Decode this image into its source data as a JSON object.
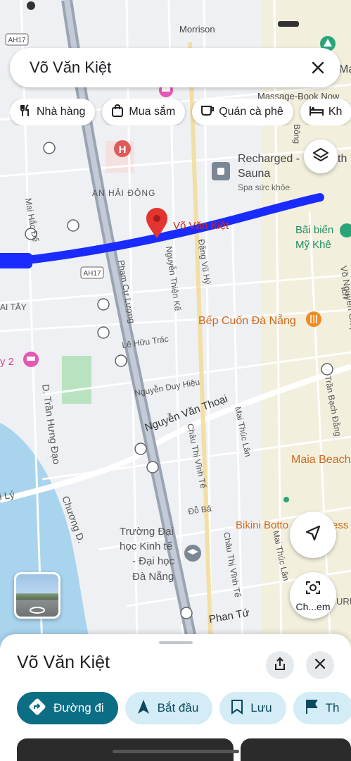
{
  "map": {
    "route_color": "#1a2bff",
    "pin_label": "Võ Văn Kiệt",
    "highway_labels": [
      "AH17",
      "AH17"
    ],
    "places": {
      "morrison": "Morrison",
      "massage": "Massage-Book Now",
      "recharged": "Recharged - ",
      "recharged_suffix": "th",
      "sauna": "Sauna",
      "spa": "Spa sức khỏe",
      "an_hai_dong": "AN HẢI ĐÔNG",
      "bai_bien": "Bãi biển",
      "my_khe": "Mỹ Khê",
      "bep_cuon": "Bếp Cuốn Đà Nẵng",
      "maia_beach": "Maia Beach",
      "bikini": "Bikini Botto",
      "bikini_suffix": "ess",
      "truong_dh1": "Trường Đại",
      "truong_dh2": "học Kinh tế",
      "truong_dh3": "- Đại học",
      "truong_dh4": "Đà Nẵng",
      "hotel_2": "y 2",
      "ai_tay": "AI TÂY",
      "ma_edge": "Ma",
      "uru": "URU",
      "bong": "Bông"
    },
    "streets": {
      "mai_hac_de": "Mai Hắc Đế",
      "pham_cu_luong": "Phạm Cự Lượng",
      "nguyen_thien_ke": "Nguyễn Thiện Kế",
      "dang_vu_hy": "Đặng Vũ Hỷ",
      "vo_nguyen_giap": "Võ Nguyên Giáp",
      "le_huu_trac": "Lê Hữu Trác",
      "nguyen_duy_hieu": "Nguyễn Duy Hiệu",
      "nguyen_van_thoai": "Nguyễn Văn Thoại",
      "chau_thi_vinh_te": "Châu Thị Vĩnh Tế",
      "mai_thuc_lan": "Mai Thúc Lân",
      "tran_bach_dang": "Trần Bạch Đằng",
      "tran_hung_dao": "D. Trần Hưng Đạo",
      "chuong_d": "Chương D.",
      "i_ly": "i Lý",
      "do_ba": "Đỗ Bá",
      "mai_thuc_lan2": "Mai Thúc Lân",
      "chau_thi_vinh_te2": "Châu Thị Vĩnh Tế",
      "phan_tu": "Phan Tứ",
      "ich": "ich"
    }
  },
  "search": {
    "query": "Võ Văn Kiệt"
  },
  "chips": [
    {
      "label": "Nhà hàng",
      "icon": "restaurant-icon"
    },
    {
      "label": "Mua sắm",
      "icon": "shopping-bag-icon"
    },
    {
      "label": "Quán cà phê",
      "icon": "coffee-icon"
    },
    {
      "label": "Kh",
      "icon": "hotel-icon"
    }
  ],
  "lens": {
    "label": "Ch...em"
  },
  "sheet": {
    "title": "Võ Văn Kiệt",
    "actions": [
      {
        "label": "Đường đi",
        "icon": "directions-icon"
      },
      {
        "label": "Bắt đầu",
        "icon": "navigation-arrow-icon"
      },
      {
        "label": "Lưu",
        "icon": "bookmark-icon"
      },
      {
        "label": "Th",
        "icon": "flag-icon"
      }
    ]
  }
}
